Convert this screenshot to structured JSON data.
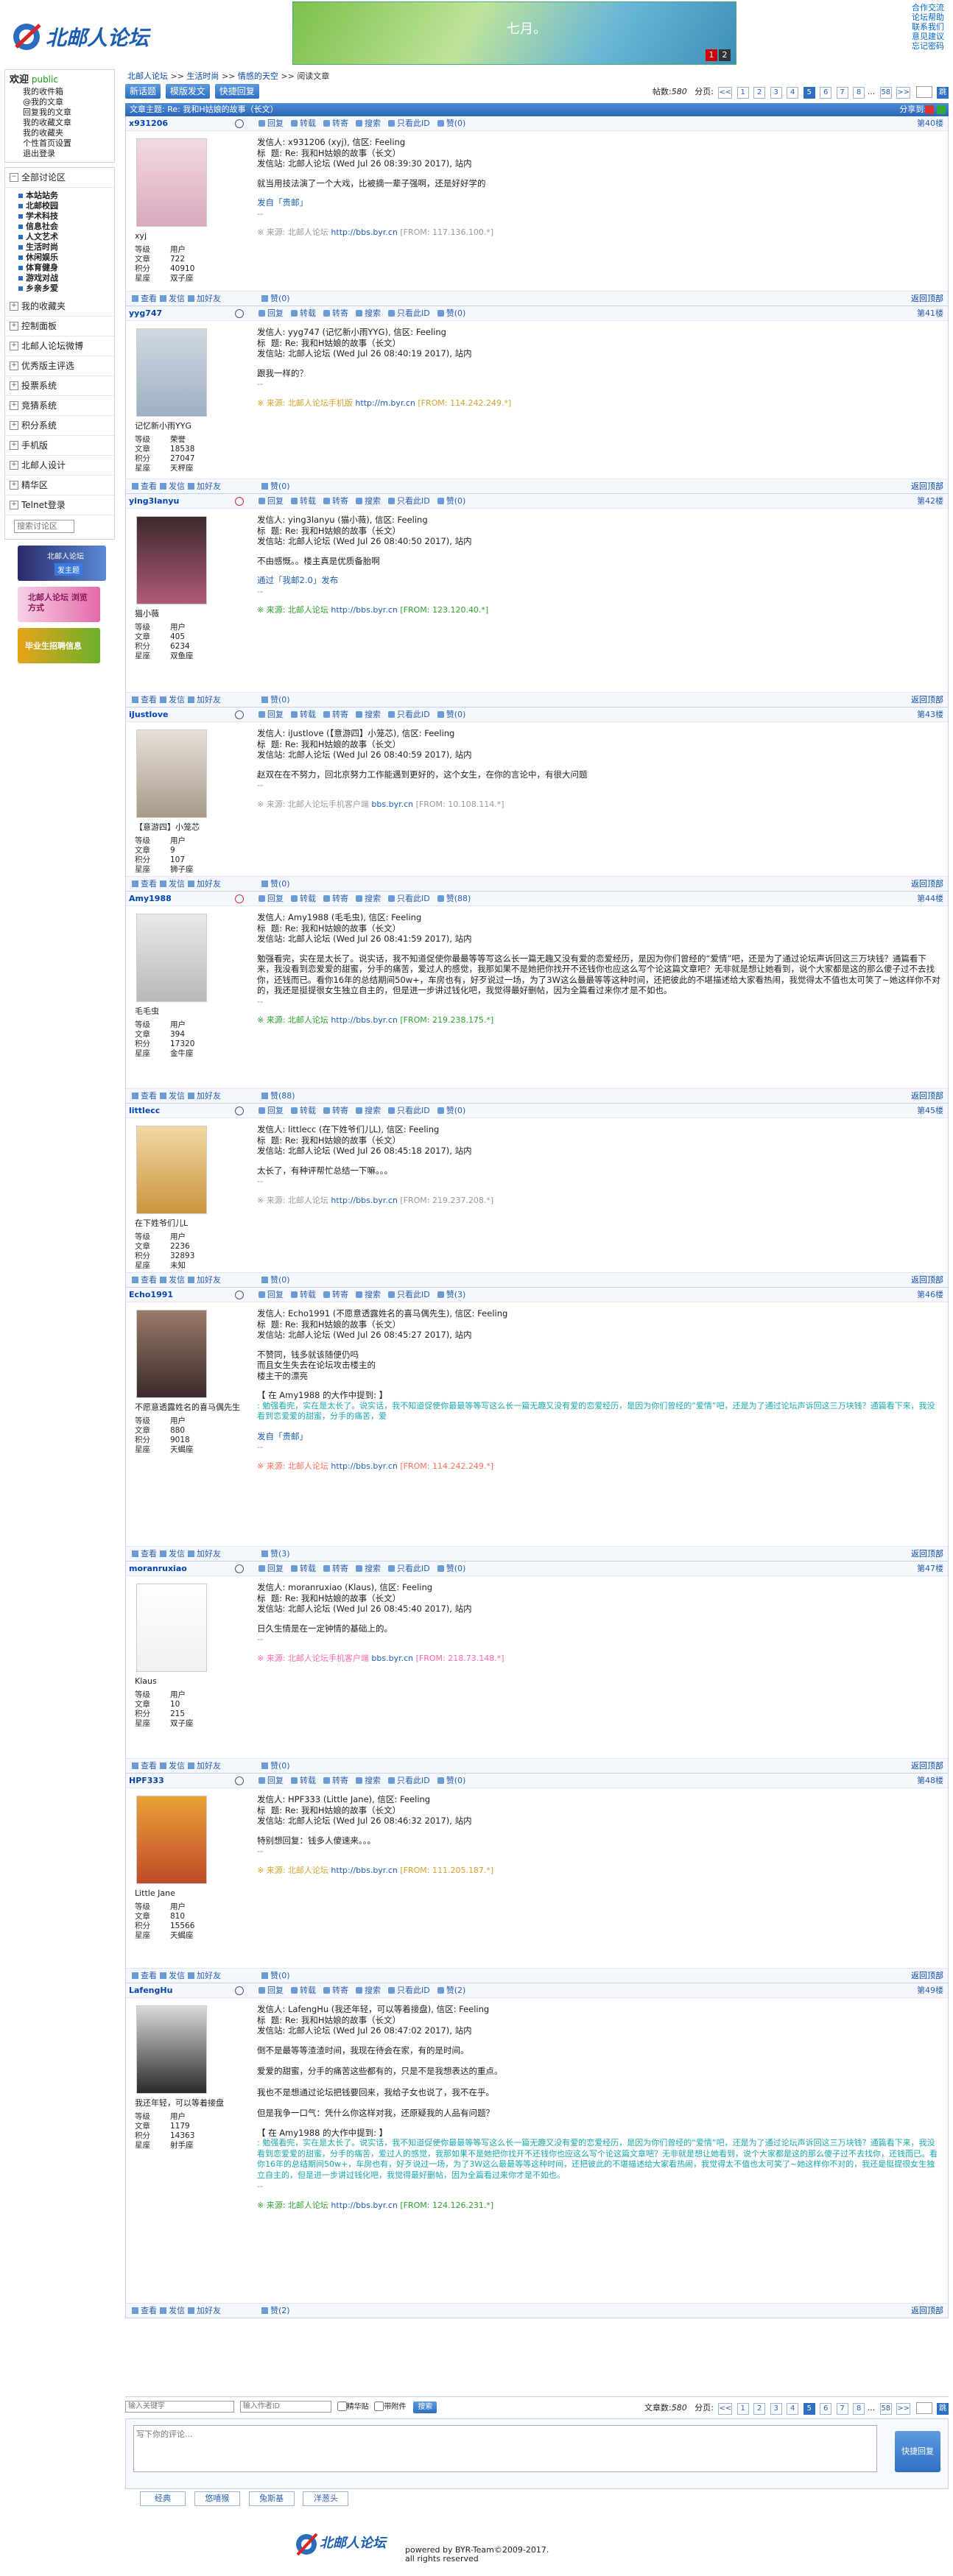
{
  "site": {
    "logo": "北邮人论坛",
    "banner_text": "七月。",
    "banner_pages": [
      "1",
      "2"
    ]
  },
  "toplinks": [
    "合作交流",
    "论坛帮助",
    "联系我们",
    "意见建议",
    "忘记密码"
  ],
  "left": {
    "welcome": "欢迎",
    "user": "public",
    "user_links": [
      "我的收件箱",
      "@我的文章",
      "回复我的文章",
      "我的收藏文章",
      "我的收藏夹",
      "个性首页设置",
      "退出登录"
    ],
    "sections": [
      "全部讨论区",
      "我的收藏夹",
      "控制面板",
      "北邮人论坛微博",
      "优秀版主评选",
      "投票系统",
      "竞猜系统",
      "积分系统",
      "手机版",
      "北邮人设计",
      "精华区",
      "Telnet登录"
    ],
    "boards": [
      "本站站务",
      "北邮校园",
      "学术科技",
      "信息社会",
      "人文艺术",
      "生活时尚",
      "休闲娱乐",
      "体育健身",
      "游戏对战",
      "乡亲乡爱"
    ],
    "search_placeholder": "搜索讨论区",
    "promo1": "北邮人论坛",
    "promo1b": "发主题",
    "promo2": "北邮人论坛 浏览方式",
    "promo3": "毕业生招聘信息"
  },
  "crumb": [
    "北邮人论坛",
    ">>",
    "生活时尚",
    ">>",
    "情感的天空",
    ">>",
    "阅读文章"
  ],
  "toolbar": {
    "new_topic": "新话题",
    "tpl_post": "模版发文",
    "quick_reply": "快捷回复",
    "count_label": "帖数:",
    "count": "580",
    "page_label": "分页:"
  },
  "pages": [
    "<<",
    "1",
    "2",
    "3",
    "4",
    "5",
    "6",
    "7",
    "8",
    "...",
    "58",
    ">>"
  ],
  "go_label": "跳",
  "title_bar": {
    "label": "文章主题: Re: 我和H姑娘的故事（长文）",
    "share": "分享到:",
    "share_colors": [
      "#d33",
      "#27a",
      "#3a3"
    ]
  },
  "actions": [
    "回复",
    "转载",
    "转寄",
    "搜索",
    "只看此ID",
    "赞"
  ],
  "foot_actions": [
    "查看",
    "发信",
    "加好友"
  ],
  "top_link": "返回顶部",
  "stat_labels": [
    "等级",
    "文章",
    "积分",
    "星座"
  ],
  "posts": [
    {
      "id": "x931206",
      "nick": "xyj",
      "floor": "第40楼",
      "likes": "(0)",
      "likes2": "赞(0)",
      "stats": [
        "用户",
        "722",
        "40910",
        "双子座"
      ],
      "lines": [
        "发信人: x931206 (xyj), 信区: Feeling",
        "标  题: Re: 我和H姑娘的故事（长文）",
        "发信站: 北邮人论坛 (Wed Jul 26 08:39:30 2017), 站内"
      ],
      "body": [
        "就当用技法演了一个大戏，比被摘一辈子强啊，还是好好学的"
      ],
      "sign": "发自「贵邮」",
      "src_pre": "※ 来源: 北邮人论坛 ",
      "src_link": "http://bbs.byr.cn",
      "src_from": " [FROM: 117.136.100.*]"
    },
    {
      "id": "yyg747",
      "nick": "记忆新小雨YYG",
      "floor": "第41楼",
      "likes": "(0)",
      "likes2": "赞(0)",
      "stats": [
        "荣誉",
        "18538",
        "27047",
        "天秤座"
      ],
      "lines": [
        "发信人: yyg747 (记忆新小雨YYG), 信区: Feeling",
        "标  题: Re: 我和H姑娘的故事（长文）",
        "发信站: 北邮人论坛 (Wed Jul 26 08:40:19 2017), 站内"
      ],
      "body": [
        "跟我一样的？"
      ],
      "sign": "",
      "src_pre": "※ 来源: 北邮人论坛手机版 ",
      "src_link": "http://m.byr.cn",
      "src_from": " [FROM: 114.242.249.*]"
    },
    {
      "id": "ying3lanyu",
      "nick": "猫小薇",
      "floor": "第42楼",
      "likes": "(0)",
      "likes2": "赞(0)",
      "stats": [
        "用户",
        "405",
        "6234",
        "双鱼座"
      ],
      "lines": [
        "发信人: ying3lanyu (猫小薇), 信区: Feeling",
        "标  题: Re: 我和H姑娘的故事（长文）",
        "发信站: 北邮人论坛 (Wed Jul 26 08:40:50 2017), 站内"
      ],
      "body": [
        "不由感慨。。楼主真是优质备胎啊"
      ],
      "sign": "通过「我邮2.0」发布",
      "src_pre": "※ 来源: 北邮人论坛 ",
      "src_link": "http://bbs.byr.cn",
      "src_from": " [FROM: 123.120.40.*]"
    },
    {
      "id": "iJustlove",
      "nick": "【意游四】小笼芯",
      "floor": "第43楼",
      "likes": "(0)",
      "likes2": "赞(0)",
      "stats": [
        "用户",
        "9",
        "107",
        "狮子座"
      ],
      "lines": [
        "发信人: iJustlove (【意游四】小笼芯), 信区: Feeling",
        "标  题: Re: 我和H姑娘的故事（长文）",
        "发信站: 北邮人论坛 (Wed Jul 26 08:40:59 2017), 站内"
      ],
      "body": [
        "赵双在在不努力，回北京努力工作能遇到更好的，这个女生，在你的言论中，有很大问题"
      ],
      "sign": "",
      "src_pre": "※ 来源: 北邮人论坛手机客户端 ",
      "src_link": "bbs.byr.cn",
      "src_from": " [FROM: 10.108.114.*]"
    },
    {
      "id": "Amy1988",
      "nick": "毛毛虫",
      "floor": "第44楼",
      "likes": "(88)",
      "likes2": "赞(88)",
      "stats": [
        "用户",
        "394",
        "17320",
        "金牛座"
      ],
      "lines": [
        "发信人: Amy1988 (毛毛虫), 信区: Feeling",
        "标  题: Re: 我和H姑娘的故事（长文）",
        "发信站: 北邮人论坛 (Wed Jul 26 08:41:59 2017), 站内"
      ],
      "body": [
        "勉强看完，实在是太长了。说实话，我不知道促使你最最等等写这么长一篇无趣又没有爱的恋爱经历，是因为你们曾经的“爱情”吧，还是为了通过论坛声诉回这三万块钱？通篇看下来，我没看到恋爱爱的甜蜜，分手的痛苦，爱过人的感觉，我那如果不是她把你找开不还钱你也应这么写个论这篇文章吧？无非就是想让她看到，说个大家都是这的那么傻子过不去找你，还钱而已。看你16年的总结期间50w+，车房也有，好歹说过一场，为了3W这么最最等等这种时间，还把彼此的不堪描述给大家看热闹，我觉得太不值也太可笑了~她这样你不对的，我还是挺提很女生独立自主的，但是进一步讲过钱化吧，我觉得最好删帖，因为全篇看过来你才是不如也。"
      ],
      "sign": "",
      "src_pre": "※ 来源: 北邮人论坛 ",
      "src_link": "http://bbs.byr.cn",
      "src_from": " [FROM: 219.238.175.*]"
    },
    {
      "id": "littlecc",
      "nick": "在下姓爷们儿L",
      "floor": "第45楼",
      "likes": "(0)",
      "likes2": "赞(0)",
      "stats": [
        "用户",
        "2236",
        "32893",
        "未知"
      ],
      "lines": [
        "发信人: littlecc (在下姓爷们儿L), 信区: Feeling",
        "标  题: Re: 我和H姑娘的故事（长文）",
        "发信站: 北邮人论坛 (Wed Jul 26 08:45:18 2017), 站内"
      ],
      "body": [
        "太长了，有种评帮忙总结一下嘛。。。"
      ],
      "sign": "",
      "src_pre": "※ 来源: 北邮人论坛 ",
      "src_link": "http://bbs.byr.cn",
      "src_from": " [FROM: 219.237.208.*]"
    },
    {
      "id": "Echo1991",
      "nick": "不愿意透露姓名的喜马偶先生",
      "floor": "第46楼",
      "likes": "(3)",
      "likes2": "赞(3)",
      "stats": [
        "用户",
        "880",
        "9018",
        "天蝎座"
      ],
      "lines": [
        "发信人: Echo1991 (不愿意透露姓名的喜马偶先生), 信区: Feeling",
        "标  题: Re: 我和H姑娘的故事（长文）",
        "发信站: 北邮人论坛 (Wed Jul 26 08:45:27 2017), 站内"
      ],
      "body": [
        "不赞同，钱多就该随便仍吗",
        "而且女生失去在论坛攻击楼主的",
        "楼主干的漂亮"
      ],
      "quote_head": "【 在 Amy1988 的大作中提到: 】",
      "quote": ": 勉强看完，实在是太长了。说实话，我不知道促使你最最等等写这么长一篇无趣又没有爱的恋爱经历，是因为你们曾经的“爱情”吧，还是为了通过论坛声诉回这三万块钱？通篇看下来，我没看到恋爱爱的甜蜜，分手的痛苦，爱",
      "sign": "发自「贵邮」",
      "src_pre": "※ 来源: 北邮人论坛 ",
      "src_link": "http://bbs.byr.cn",
      "src_from": " [FROM: 114.242.249.*]"
    },
    {
      "id": "moranruxiao",
      "nick": "Klaus",
      "floor": "第47楼",
      "likes": "(0)",
      "likes2": "赞(0)",
      "stats": [
        "用户",
        "10",
        "215",
        "双子座"
      ],
      "lines": [
        "发信人: moranruxiao (Klaus), 信区: Feeling",
        "标  题: Re: 我和H姑娘的故事（长文）",
        "发信站: 北邮人论坛 (Wed Jul 26 08:45:40 2017), 站内"
      ],
      "body": [
        "日久生情是在一定钟情的基础上的。"
      ],
      "sign": "",
      "src_pre": "※ 来源: 北邮人论坛手机客户端 ",
      "src_link": "bbs.byr.cn",
      "src_from": " [FROM: 218.73.148.*]"
    },
    {
      "id": "HPF333",
      "nick": "Little Jane",
      "floor": "第48楼",
      "likes": "(0)",
      "likes2": "赞(0)",
      "stats": [
        "用户",
        "810",
        "15566",
        "天蝎座"
      ],
      "lines": [
        "发信人: HPF333 (Little Jane), 信区: Feeling",
        "标  题: Re: 我和H姑娘的故事（长文）",
        "发信站: 北邮人论坛 (Wed Jul 26 08:46:32 2017), 站内"
      ],
      "body": [
        "特别想回复：钱多人傻速来。。。"
      ],
      "sign": "",
      "src_pre": "※ 来源: 北邮人论坛 ",
      "src_link": "http://bbs.byr.cn",
      "src_from": " [FROM: 111.205.187.*]"
    },
    {
      "id": "LafengHu",
      "nick": "我还年轻，可以等着接盘",
      "floor": "第49楼",
      "likes": "(2)",
      "likes2": "赞(2)",
      "stats": [
        "用户",
        "1179",
        "14363",
        "射手座"
      ],
      "lines": [
        "发信人: LafengHu (我还年轻，可以等着接盘), 信区: Feeling",
        "标  题: Re: 我和H姑娘的故事（长文）",
        "发信站: 北邮人论坛 (Wed Jul 26 08:47:02 2017), 站内"
      ],
      "body": [
        "倒不是最等等渣渣时间，我现在待会在家，有的是时间。",
        "",
        "爱爱的甜蜜，分手的痛苦这些都有的，只是不是我想表达的重点。",
        "",
        "我也不是想通过论坛把钱要回来，我给子女也说了，我不在乎。",
        "",
        "但是我争一口气：凭什么你这样对我，还原疑我的人品有问题？"
      ],
      "quote_head": "【 在 Amy1988 的大作中提到: 】",
      "quote": ": 勉强看完，实在是太长了。说实话，我不知道促使你最最等等写这么长一篇无趣又没有爱的恋爱经历，是因为你们曾经的“爱情”吧，还是为了通过论坛声诉回这三万块钱？通篇看下来，我没看到恋爱爱的甜蜜，分手的痛苦，爱过人的感觉，我那如果不是她把你找开不还钱你也应这么写个论这篇文章吧？无非就是想让她看到，说个大家都是这的那么傻子过不去找你，还钱而已。看你16年的总结期间50w+，车房也有，好歹说过一场，为了3W这么最最等等这种时间，还把彼此的不堪描述给大家看热闹，我觉得太不值也太可笑了~她这样你不对的，我还是挺提很女生独立自主的，但是进一步讲过钱化吧，我觉得最好删帖，因为全篇看过来你才是不如也。",
      "sign": "",
      "src_pre": "※ 来源: 北邮人论坛 ",
      "src_link": "http://bbs.byr.cn",
      "src_from": " [FROM: 124.126.231.*]"
    }
  ],
  "bottom": {
    "kw_placeholder": "输入关键字",
    "user_placeholder": "输入作者ID",
    "opt1": "精华贴",
    "opt2": "带附件",
    "search_btn": "搜索",
    "count_label": "文章数:",
    "count": "580",
    "page_label": "分页:"
  },
  "reply": {
    "placeholder": "写下你的评论...",
    "btn": "快捷回复",
    "emos": [
      "经典",
      "悠嘻猴",
      "兔斯基",
      "洋葱头"
    ]
  },
  "footer": {
    "logo": "北邮人论坛",
    "powered": "powered by BYR-Team©2009-2017.",
    "rights": "all rights reserved"
  },
  "colors": {
    "accent": "#2f6fc4",
    "src_colors": [
      "#999",
      "#d4a12a",
      "#2ca02c",
      "#999",
      "#2ca02c",
      "#999",
      "#ff6b5b",
      "#ff66aa",
      "#d4a12a",
      "#2ca02c"
    ]
  }
}
